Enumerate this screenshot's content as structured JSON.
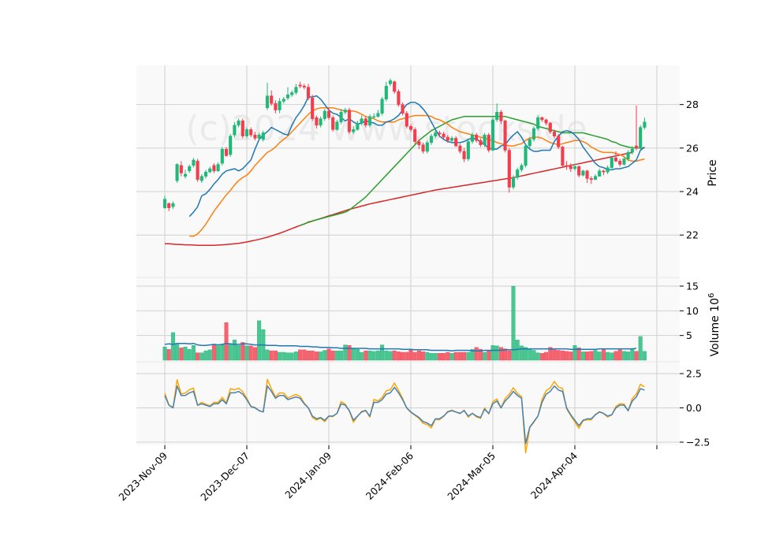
{
  "chart_data": {
    "type": "candlestick",
    "watermark": "(c)2024 www.stockside",
    "colors": {
      "panel_bg": "#f9f9f9",
      "grid": "#d0d0d0",
      "up": "#1fb878",
      "down": "#f33d4d",
      "sma5": "#1f77b4",
      "sma10": "#ff7f0e",
      "sma20": "#2ca02c",
      "sma100": "#d62728",
      "vol_avg": "#1f77b4",
      "osc1": "#4682b4",
      "osc2": "#ffa500"
    },
    "x_tick_labels": [
      "2023-Nov-09",
      "2023-Dec-07",
      "2024-Jan-09",
      "2024-Feb-06",
      "2024-Mar-05",
      "2024-Apr-04"
    ],
    "x_tick_index": [
      0,
      20,
      40,
      60,
      80,
      100
    ],
    "price_panel": {
      "ylabel": "Price",
      "ylim": [
        20.05,
        29.8
      ],
      "ticks": [
        22,
        24,
        26,
        28
      ],
      "tick_labels": [
        "22",
        "24",
        "26",
        "28"
      ]
    },
    "volume_panel": {
      "ylabel": "Volume",
      "scale_label": "10",
      "scale_exp": "6",
      "ylim": [
        0,
        15
      ],
      "ticks": [
        5,
        10,
        15
      ],
      "tick_labels": [
        "5",
        "10",
        "15"
      ]
    },
    "osc_panel": {
      "ylim": [
        -2.8,
        3.2
      ],
      "ticks": [
        -2.5,
        0.0,
        2.5
      ],
      "tick_labels": [
        "−2.5",
        "0.0",
        "2.5"
      ]
    },
    "close": [
      23.65,
      23.25,
      23.45,
      25.25,
      24.85,
      24.8,
      25.15,
      25.45,
      24.55,
      24.7,
      24.9,
      25.05,
      24.95,
      25.25,
      25.95,
      25.65,
      26.55,
      27.05,
      27.25,
      26.55,
      26.85,
      26.6,
      26.45,
      26.6,
      26.7,
      28.4,
      28.05,
      27.75,
      28.15,
      28.25,
      28.45,
      28.55,
      28.8,
      28.85,
      28.8,
      28.3,
      27.35,
      27.05,
      27.35,
      27.7,
      27.4,
      26.85,
      27.2,
      27.65,
      27.75,
      26.75,
      26.85,
      27.15,
      27.35,
      27.05,
      27.45,
      27.45,
      27.6,
      28.25,
      28.85,
      29.1,
      28.6,
      28.0,
      27.6,
      27.0,
      26.85,
      26.3,
      26.15,
      25.85,
      26.25,
      26.55,
      26.7,
      26.65,
      26.5,
      26.35,
      26.45,
      26.1,
      25.85,
      25.5,
      26.3,
      26.6,
      26.35,
      26.15,
      26.6,
      25.9,
      27.3,
      27.65,
      27.25,
      25.9,
      24.2,
      24.65,
      25.0,
      25.2,
      26.1,
      26.4,
      26.9,
      27.4,
      27.3,
      27.15,
      26.75,
      26.55,
      26.05,
      25.2,
      25.15,
      25.05,
      25.15,
      24.75,
      24.95,
      24.6,
      24.55,
      24.7,
      24.95,
      24.9,
      25.1,
      25.55,
      25.4,
      25.25,
      25.5,
      25.8,
      25.95,
      26.0,
      26.95,
      27.2
    ],
    "open": [
      23.25,
      23.45,
      23.3,
      24.5,
      25.2,
      24.7,
      24.95,
      25.2,
      25.4,
      24.5,
      24.7,
      24.9,
      25.2,
      24.95,
      25.3,
      25.95,
      25.7,
      26.6,
      27.05,
      27.25,
      26.55,
      26.85,
      26.6,
      26.45,
      26.4,
      27.85,
      28.4,
      28.05,
      27.75,
      28.15,
      28.3,
      28.45,
      28.55,
      28.9,
      28.85,
      28.8,
      28.3,
      27.4,
      27.05,
      27.35,
      27.7,
      27.4,
      26.85,
      27.2,
      27.65,
      27.75,
      26.75,
      26.85,
      27.15,
      27.35,
      27.05,
      27.45,
      27.45,
      27.6,
      28.25,
      28.95,
      29.05,
      28.6,
      28.0,
      27.6,
      27.0,
      26.85,
      26.3,
      26.15,
      25.85,
      26.25,
      26.55,
      26.7,
      26.65,
      26.5,
      26.35,
      26.45,
      26.1,
      25.85,
      25.5,
      26.3,
      26.6,
      26.35,
      26.15,
      26.6,
      25.9,
      27.3,
      27.65,
      27.25,
      25.9,
      24.2,
      24.65,
      25.0,
      25.2,
      26.1,
      26.4,
      26.9,
      27.4,
      27.3,
      27.15,
      26.75,
      26.55,
      26.05,
      25.2,
      25.15,
      25.05,
      25.15,
      24.75,
      24.95,
      24.6,
      24.55,
      24.7,
      24.95,
      24.9,
      25.1,
      25.55,
      25.4,
      25.25,
      25.5,
      25.8,
      26.1,
      26.0,
      26.95
    ],
    "high": [
      23.8,
      23.5,
      23.55,
      25.3,
      25.4,
      25.0,
      25.25,
      25.55,
      25.5,
      24.8,
      25.0,
      25.15,
      25.3,
      25.35,
      26.05,
      26.05,
      26.65,
      27.2,
      27.35,
      27.35,
      26.95,
      26.95,
      26.75,
      26.7,
      26.8,
      29.0,
      28.65,
      28.2,
      28.3,
      28.35,
      28.8,
      28.65,
      28.95,
      29.05,
      28.95,
      28.95,
      28.45,
      27.5,
      27.45,
      27.8,
      27.85,
      27.5,
      27.3,
      27.8,
      27.85,
      27.85,
      27.0,
      27.25,
      27.5,
      27.45,
      27.55,
      27.6,
      27.75,
      28.35,
      29.05,
      29.2,
      29.1,
      28.7,
      28.1,
      27.7,
      27.1,
      26.95,
      26.4,
      26.25,
      26.35,
      26.65,
      26.8,
      26.8,
      26.75,
      26.6,
      26.55,
      26.55,
      26.2,
      26.0,
      26.4,
      26.7,
      26.7,
      26.45,
      26.7,
      26.7,
      27.45,
      28.05,
      27.75,
      27.3,
      26.0,
      24.75,
      25.1,
      25.3,
      26.2,
      26.5,
      27.0,
      27.5,
      27.45,
      27.35,
      27.2,
      26.85,
      26.65,
      26.1,
      25.4,
      25.3,
      25.3,
      25.2,
      25.0,
      25.0,
      24.7,
      24.8,
      25.05,
      25.0,
      25.2,
      25.6,
      25.85,
      25.5,
      25.6,
      25.9,
      26.1,
      27.95,
      27.05,
      27.4
    ],
    "low": [
      23.2,
      23.1,
      23.2,
      24.4,
      24.7,
      24.6,
      24.85,
      25.1,
      24.45,
      24.4,
      24.6,
      24.85,
      24.85,
      24.9,
      25.2,
      25.6,
      25.6,
      26.5,
      26.95,
      26.45,
      26.45,
      26.5,
      26.35,
      26.35,
      26.3,
      27.75,
      27.95,
      27.6,
      27.6,
      28.05,
      28.2,
      28.35,
      28.45,
      28.75,
      28.7,
      28.2,
      27.25,
      26.9,
      26.95,
      27.25,
      27.3,
      26.75,
      26.8,
      27.1,
      27.55,
      26.65,
      26.65,
      26.8,
      27.05,
      26.95,
      26.95,
      27.35,
      27.4,
      27.5,
      28.15,
      28.85,
      28.5,
      27.9,
      27.5,
      26.9,
      26.75,
      26.2,
      25.95,
      25.75,
      25.75,
      26.15,
      26.45,
      26.5,
      26.4,
      26.25,
      26.25,
      26.05,
      25.75,
      25.35,
      25.4,
      26.2,
      26.25,
      26.05,
      26.05,
      25.8,
      25.85,
      27.2,
      27.1,
      25.8,
      23.95,
      24.1,
      24.55,
      24.9,
      25.1,
      26.0,
      26.3,
      26.8,
      27.2,
      27.05,
      26.65,
      26.45,
      25.95,
      25.1,
      25.0,
      24.9,
      24.95,
      24.65,
      24.7,
      24.4,
      24.35,
      24.55,
      24.75,
      24.75,
      24.8,
      25.05,
      25.35,
      25.15,
      25.2,
      25.4,
      25.7,
      25.9,
      25.9,
      26.85
    ],
    "volume": [
      2.7,
      2.2,
      5.6,
      3.2,
      2.5,
      2.7,
      2.2,
      3.0,
      1.5,
      1.5,
      1.9,
      2.1,
      3.2,
      2.9,
      3.2,
      7.6,
      3.2,
      4.1,
      3.0,
      3.6,
      2.9,
      2.9,
      2.6,
      8.0,
      6.2,
      2.1,
      1.9,
      1.9,
      1.6,
      1.6,
      1.5,
      1.5,
      1.7,
      2.1,
      2.1,
      1.9,
      1.9,
      1.7,
      1.7,
      2.0,
      2.3,
      1.9,
      1.9,
      1.9,
      3.1,
      3.0,
      2.3,
      2.2,
      1.6,
      1.9,
      1.9,
      1.8,
      1.9,
      3.1,
      1.9,
      1.8,
      1.9,
      1.7,
      1.6,
      1.6,
      2.1,
      1.6,
      1.9,
      1.7,
      1.6,
      1.4,
      1.4,
      1.4,
      1.4,
      1.6,
      1.4,
      1.6,
      1.6,
      1.6,
      1.6,
      2.2,
      2.6,
      2.2,
      1.6,
      2.0,
      3.0,
      2.9,
      2.6,
      2.3,
      1.9,
      15.0,
      4.1,
      2.9,
      2.6,
      2.2,
      2.0,
      1.5,
      1.4,
      1.6,
      2.6,
      2.1,
      2.0,
      1.9,
      1.8,
      1.7,
      3.0,
      2.5,
      1.7,
      1.7,
      1.8,
      2.0,
      1.7,
      2.3,
      1.6,
      1.5,
      1.8,
      2.1,
      1.8,
      1.7,
      2.3,
      1.8,
      4.8,
      1.8
    ],
    "volume_avg": [
      3.2,
      3.3,
      3.2,
      3.4,
      3.4,
      3.4,
      3.3,
      3.4,
      3.1,
      3.0,
      3.0,
      3.1,
      3.2,
      3.1,
      3.2,
      3.4,
      3.3,
      3.2,
      3.2,
      3.3,
      3.3,
      3.2,
      3.1,
      3.1,
      3.1,
      3.0,
      3.0,
      3.0,
      2.9,
      2.9,
      2.9,
      2.9,
      2.9,
      2.8,
      2.8,
      2.8,
      2.7,
      2.7,
      2.6,
      2.6,
      2.6,
      2.5,
      2.5,
      2.4,
      2.4,
      2.4,
      2.4,
      2.4,
      2.4,
      2.4,
      2.3,
      2.3,
      2.3,
      2.3,
      2.3,
      2.3,
      2.3,
      2.3,
      2.2,
      2.2,
      2.2,
      2.1,
      2.1,
      2.1,
      2.1,
      2.0,
      2.0,
      2.0,
      2.0,
      2.0,
      1.9,
      2.0,
      2.0,
      2.0,
      2.0,
      1.9,
      1.9,
      1.9,
      2.0,
      2.0,
      2.0,
      2.0,
      2.0,
      2.1,
      2.1,
      2.1,
      2.2,
      2.3,
      2.3,
      2.3,
      2.3,
      2.3,
      2.3,
      2.3,
      2.3,
      2.3,
      2.3,
      2.3,
      2.3,
      2.2,
      2.2,
      2.2,
      2.2,
      2.2,
      2.2,
      2.2,
      2.3,
      2.3,
      2.3,
      2.3,
      2.3,
      2.3,
      2.3,
      2.3,
      2.3,
      2.4
    ],
    "sma5": [
      22.85,
      23.05,
      23.3,
      23.8,
      23.9,
      24.1,
      24.35,
      24.55,
      24.8,
      24.95,
      25.0,
      25.05,
      24.95,
      25.05,
      25.25,
      25.45,
      25.95,
      26.4,
      26.6,
      26.75,
      26.95,
      26.85,
      26.75,
      26.65,
      26.6,
      27.05,
      27.4,
      27.65,
      27.95,
      28.35,
      28.35,
      28.4,
      28.25,
      28.0,
      27.75,
      27.6,
      27.55,
      27.4,
      27.25,
      27.35,
      27.2,
      27.1,
      27.15,
      27.25,
      27.2,
      27.15,
      27.05,
      27.05,
      27.2,
      27.25,
      27.35,
      27.5,
      27.75,
      28.0,
      28.1,
      28.1,
      28.0,
      27.8,
      27.55,
      27.2,
      26.85,
      26.55,
      26.4,
      26.3,
      26.25,
      26.25,
      26.25,
      26.3,
      26.4,
      26.45,
      26.4,
      26.3,
      26.15,
      26.0,
      25.95,
      25.95,
      26.1,
      26.15,
      26.4,
      26.6,
      26.75,
      26.5,
      26.15,
      25.95,
      25.85,
      25.85,
      25.9,
      25.9,
      25.9,
      26.3,
      26.55,
      26.75,
      26.8,
      26.75,
      26.6,
      26.4,
      26.05,
      25.8,
      25.55,
      25.3,
      25.15,
      25.1,
      25.0,
      25.0,
      25.05,
      25.05,
      25.1,
      25.15,
      25.3,
      25.45,
      25.9,
      26.05
    ],
    "sma10": [
      21.95,
      21.95,
      22.05,
      22.25,
      22.5,
      22.8,
      23.1,
      23.35,
      23.6,
      23.85,
      24.05,
      24.3,
      24.5,
      24.65,
      24.75,
      24.95,
      25.2,
      25.4,
      25.6,
      25.8,
      25.9,
      26.05,
      26.25,
      26.4,
      26.55,
      26.75,
      26.95,
      27.15,
      27.35,
      27.55,
      27.7,
      27.8,
      27.85,
      27.85,
      27.85,
      27.85,
      27.8,
      27.75,
      27.7,
      27.7,
      27.7,
      27.65,
      27.55,
      27.45,
      27.4,
      27.35,
      27.25,
      27.2,
      27.2,
      27.2,
      27.2,
      27.3,
      27.35,
      27.4,
      27.45,
      27.5,
      27.5,
      27.5,
      27.5,
      27.45,
      27.35,
      27.3,
      27.2,
      27.1,
      26.95,
      26.85,
      26.75,
      26.7,
      26.65,
      26.6,
      26.55,
      26.5,
      26.45,
      26.4,
      26.35,
      26.25,
      26.2,
      26.15,
      26.1,
      26.1,
      26.15,
      26.2,
      26.35,
      26.45,
      26.5,
      26.5,
      26.45,
      26.35,
      26.25,
      26.2,
      26.15,
      26.2,
      26.25,
      26.3,
      26.35,
      26.35,
      26.3,
      26.2,
      26.05,
      25.95,
      25.85,
      25.8,
      25.8,
      25.8,
      25.75,
      25.7,
      25.6,
      25.45,
      25.4,
      25.4,
      25.45,
      25.5
    ],
    "sma20": [
      22.45,
      22.5,
      22.6,
      22.65,
      22.7,
      22.75,
      22.8,
      22.85,
      22.9,
      22.95,
      23.0,
      23.05,
      23.15,
      23.3,
      23.45,
      23.6,
      23.75,
      23.95,
      24.15,
      24.35,
      24.55,
      24.75,
      24.95,
      25.15,
      25.35,
      25.55,
      25.75,
      25.95,
      26.15,
      26.35,
      26.5,
      26.65,
      26.8,
      26.9,
      27.0,
      27.1,
      27.2,
      27.3,
      27.35,
      27.4,
      27.45,
      27.45,
      27.45,
      27.45,
      27.45,
      27.45,
      27.45,
      27.45,
      27.45,
      27.45,
      27.45,
      27.4,
      27.35,
      27.3,
      27.25,
      27.2,
      27.15,
      27.1,
      27.0,
      26.95,
      26.9,
      26.85,
      26.8,
      26.75,
      26.7,
      26.7,
      26.7,
      26.7,
      26.7,
      26.7,
      26.65,
      26.6,
      26.55,
      26.5,
      26.45,
      26.4,
      26.3,
      26.25,
      26.15,
      26.1,
      26.05,
      26.0,
      26.0,
      26.0,
      26.0
    ],
    "sma100": [
      21.6,
      21.6,
      21.58,
      21.57,
      21.56,
      21.55,
      21.55,
      21.54,
      21.53,
      21.53,
      21.53,
      21.53,
      21.53,
      21.54,
      21.55,
      21.56,
      21.58,
      21.6,
      21.62,
      21.65,
      21.68,
      21.72,
      21.76,
      21.8,
      21.85,
      21.9,
      21.96,
      22.02,
      22.08,
      22.15,
      22.22,
      22.3,
      22.37,
      22.44,
      22.51,
      22.58,
      22.64,
      22.7,
      22.76,
      22.82,
      22.88,
      22.94,
      23.0,
      23.06,
      23.12,
      23.18,
      23.23,
      23.28,
      23.33,
      23.38,
      23.43,
      23.47,
      23.51,
      23.55,
      23.59,
      23.63,
      23.67,
      23.71,
      23.75,
      23.79,
      23.83,
      23.87,
      23.91,
      23.95,
      23.99,
      24.03,
      24.07,
      24.1,
      24.13,
      24.16,
      24.19,
      24.22,
      24.25,
      24.28,
      24.31,
      24.34,
      24.37,
      24.4,
      24.43,
      24.46,
      24.49,
      24.52,
      24.55,
      24.58,
      24.61,
      24.64,
      24.68,
      24.72,
      24.76,
      24.8,
      24.84,
      24.88,
      24.92,
      24.96,
      25.0,
      25.04,
      25.08,
      25.12,
      25.16,
      25.2,
      25.24,
      25.28,
      25.32,
      25.36,
      25.4,
      25.44,
      25.48,
      25.52,
      25.56,
      25.6,
      25.64,
      25.68,
      25.72,
      25.76,
      25.8
    ],
    "osc1": [
      0.9,
      0.2,
      0.0,
      1.6,
      0.9,
      0.9,
      1.1,
      1.2,
      0.2,
      0.3,
      0.2,
      0.1,
      0.3,
      0.3,
      0.6,
      0.3,
      1.1,
      1.1,
      1.2,
      1.0,
      0.6,
      0.1,
      0.0,
      -0.2,
      -0.3,
      1.6,
      1.2,
      0.7,
      0.9,
      0.9,
      0.6,
      0.7,
      0.8,
      0.7,
      0.3,
      0.0,
      -0.6,
      -0.8,
      -0.7,
      -0.9,
      -0.6,
      -0.6,
      -0.4,
      0.3,
      0.2,
      -0.2,
      -0.9,
      -0.6,
      -0.3,
      -0.2,
      -0.6,
      0.4,
      0.4,
      0.6,
      1.0,
      1.1,
      1.5,
      1.1,
      0.6,
      0.0,
      -0.3,
      -0.5,
      -0.7,
      -1.0,
      -1.1,
      -1.3,
      -0.8,
      -0.8,
      -0.6,
      -0.3,
      -0.2,
      -0.3,
      -0.4,
      -0.2,
      -0.6,
      -0.4,
      -0.6,
      -0.7,
      -0.1,
      -0.4,
      0.3,
      0.5,
      0.0,
      0.5,
      0.8,
      1.2,
      0.9,
      0.7,
      -2.6,
      -1.4,
      -1.0,
      -0.6,
      0.4,
      1.0,
      1.2,
      1.6,
      1.3,
      1.2,
      0.0,
      -0.5,
      -0.9,
      -1.3,
      -0.9,
      -0.8,
      -0.8,
      -0.5,
      -0.3,
      -0.4,
      -0.6,
      -0.5,
      0.0,
      0.2,
      0.2,
      -0.2,
      0.5,
      0.8,
      1.4,
      1.3
    ]
  }
}
